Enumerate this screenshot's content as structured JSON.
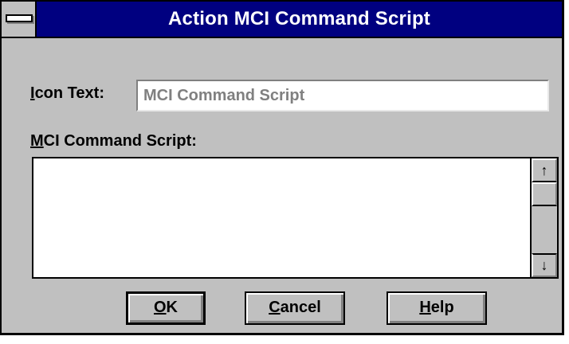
{
  "window": {
    "title": "Action MCI Command Script"
  },
  "form": {
    "icon_text_label_mnemonic": "I",
    "icon_text_label_rest": "con Text:",
    "icon_text_value": "MCI Command Script",
    "script_label_mnemonic": "M",
    "script_label_rest": "CI Command Script:",
    "script_value": ""
  },
  "scrollbar": {
    "up_glyph": "↑",
    "down_glyph": "↓"
  },
  "buttons": {
    "ok_mnemonic": "O",
    "ok_rest": "K",
    "cancel_mnemonic": "C",
    "cancel_rest": "ancel",
    "help_mnemonic": "H",
    "help_rest": "elp"
  },
  "icons": {
    "system_menu": "system-menu-icon",
    "scroll_up": "arrow-up-icon",
    "scroll_down": "arrow-down-icon"
  },
  "colors": {
    "titlebar": "#000080",
    "face": "#c0c0c0",
    "disabled_text": "#808080"
  }
}
